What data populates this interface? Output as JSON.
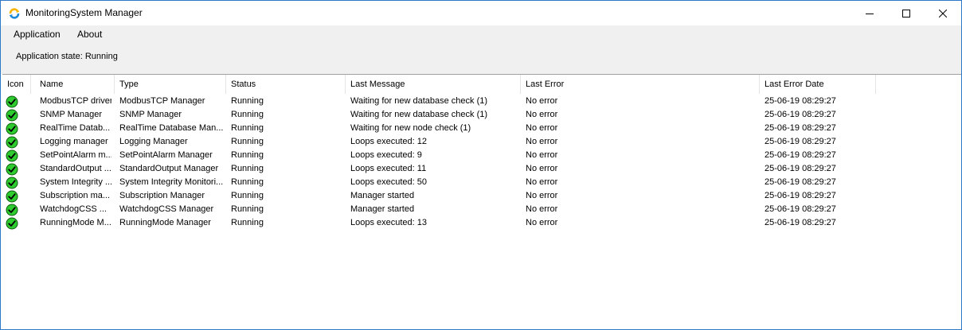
{
  "window": {
    "title": "MonitoringSystem Manager"
  },
  "menu": {
    "items": [
      {
        "label": "Application"
      },
      {
        "label": "About"
      }
    ]
  },
  "status": {
    "state_text": "Application state: Running"
  },
  "table": {
    "columns": [
      "Icon",
      "Name",
      "Type",
      "Status",
      "Last Message",
      "Last Error",
      "Last Error Date"
    ],
    "rows": [
      {
        "icon": "green-check-icon",
        "name": "ModbusTCP driver",
        "type": "ModbusTCP Manager",
        "status": "Running",
        "message": "Waiting for new database check (1)",
        "error": "No error",
        "date": "25-06-19 08:29:27"
      },
      {
        "icon": "green-check-icon",
        "name": "SNMP Manager",
        "type": "SNMP Manager",
        "status": "Running",
        "message": "Waiting for new database check (1)",
        "error": "No error",
        "date": "25-06-19 08:29:27"
      },
      {
        "icon": "green-check-icon",
        "name": "RealTime Datab...",
        "type": "RealTime Database Man...",
        "status": "Running",
        "message": "Waiting for new node check (1)",
        "error": "No error",
        "date": "25-06-19 08:29:27"
      },
      {
        "icon": "green-check-icon",
        "name": "Logging manager",
        "type": "Logging Manager",
        "status": "Running",
        "message": "Loops executed: 12",
        "error": "No error",
        "date": "25-06-19 08:29:27"
      },
      {
        "icon": "green-check-icon",
        "name": "SetPointAlarm m...",
        "type": "SetPointAlarm Manager",
        "status": "Running",
        "message": "Loops executed: 9",
        "error": "No error",
        "date": "25-06-19 08:29:27"
      },
      {
        "icon": "green-check-icon",
        "name": "StandardOutput ...",
        "type": "StandardOutput Manager",
        "status": "Running",
        "message": "Loops executed: 11",
        "error": "No error",
        "date": "25-06-19 08:29:27"
      },
      {
        "icon": "green-check-icon",
        "name": "System Integrity ...",
        "type": "System Integrity Monitori...",
        "status": "Running",
        "message": "Loops executed: 50",
        "error": "No error",
        "date": "25-06-19 08:29:27"
      },
      {
        "icon": "green-check-icon",
        "name": "Subscription ma...",
        "type": "Subscription Manager",
        "status": "Running",
        "message": "Manager started",
        "error": "No error",
        "date": "25-06-19 08:29:27"
      },
      {
        "icon": "green-check-icon",
        "name": "WatchdogCSS ...",
        "type": "WatchdogCSS Manager",
        "status": "Running",
        "message": "Manager started",
        "error": "No error",
        "date": "25-06-19 08:29:27"
      },
      {
        "icon": "green-check-icon",
        "name": "RunningMode M...",
        "type": "RunningMode Manager",
        "status": "Running",
        "message": "Loops executed: 13",
        "error": "No error",
        "date": "25-06-19 08:29:27"
      }
    ]
  },
  "colors": {
    "window_border": "#2b79c7",
    "status_ok": "#2fcc2f",
    "chrome_bg": "#f0f0f0"
  }
}
